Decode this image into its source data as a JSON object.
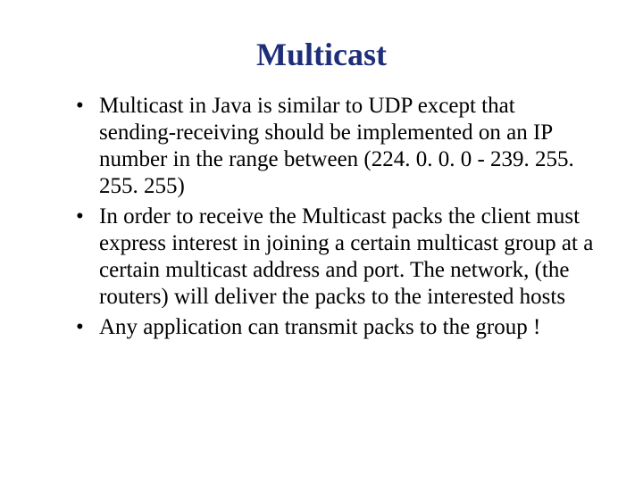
{
  "slide": {
    "title": "Multicast",
    "bullets": [
      "Multicast in Java is similar to UDP except that sending-receiving should be implemented on an IP number in the range between (224. 0. 0. 0  -  239. 255. 255. 255)",
      "In order to receive the Multicast packs the client must express interest in joining a certain multicast group at a certain multicast address and port. The network, (the routers) will deliver the packs to the interested hosts",
      "Any application can transmit packs to the group !"
    ]
  }
}
